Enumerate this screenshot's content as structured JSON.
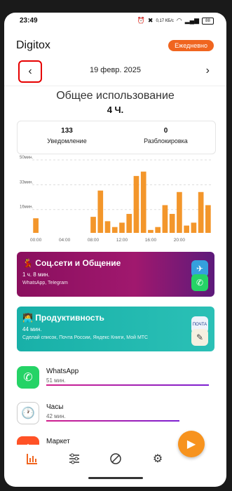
{
  "status_bar": {
    "time": "23:49",
    "network": "0,17 КБ/с",
    "battery": "88"
  },
  "header": {
    "title": "Digitox",
    "period": "Ежедневно"
  },
  "date_nav": {
    "date": "19 февр. 2025"
  },
  "usage": {
    "title": "Общее использование",
    "total": "4 Ч."
  },
  "stats": [
    {
      "value": "133",
      "label": "Уведомление"
    },
    {
      "value": "0",
      "label": "Разблокировка"
    }
  ],
  "chart_data": {
    "type": "bar",
    "x": [
      0,
      1,
      2,
      3,
      4,
      5,
      6,
      7,
      8,
      9,
      10,
      11,
      12,
      13,
      14,
      15,
      16,
      17,
      18,
      19,
      20,
      21,
      22,
      23
    ],
    "values": [
      10,
      0,
      0,
      0,
      0,
      0,
      0,
      0,
      11,
      29,
      8,
      4,
      7,
      13,
      39,
      42,
      2,
      4,
      19,
      13,
      28,
      5,
      7,
      28,
      19
    ],
    "x_ticks": [
      "00:00",
      "04:00",
      "08:00",
      "12:00",
      "16:00",
      "20:00"
    ],
    "y_ticks": [
      "50мин.",
      "33мин.",
      "16мин."
    ],
    "ylim": [
      0,
      50
    ],
    "color": "#f3962b"
  },
  "categories": [
    {
      "title": "Соц.сети и Общение",
      "time": "1 ч. 8 мин.",
      "apps": "WhatsApp, Telegram"
    },
    {
      "title": "Продуктивность",
      "time": "44 мин.",
      "apps": "Сделай список, Почта России, Яндекс Книги, Мой МТС"
    }
  ],
  "apps": [
    {
      "name": "WhatsApp",
      "time": "51 мин.",
      "fraction": 1.0
    },
    {
      "name": "Часы",
      "time": "42 мин.",
      "fraction": 0.82
    },
    {
      "name": "Маркет",
      "time": "",
      "fraction": 0.5
    }
  ],
  "icons": {
    "prev": "chevron-left",
    "next": "chevron-right",
    "fab": "play",
    "nav": [
      "stats",
      "filters",
      "block",
      "settings"
    ]
  },
  "colors": {
    "accent": "#f0651f",
    "bar": "#f3962b",
    "social": "#8a0f5e",
    "productivity": "#18b0a8"
  }
}
